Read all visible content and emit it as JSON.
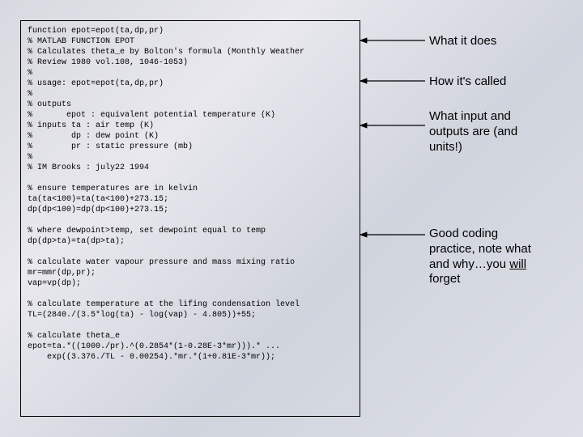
{
  "code": {
    "lines": [
      "function epot=epot(ta,dp,pr)",
      "% MATLAB FUNCTION EPOT",
      "% Calculates theta_e by Bolton's formula (Monthly Weather",
      "% Review 1980 vol.108, 1046-1053)",
      "%",
      "% usage: epot=epot(ta,dp,pr)",
      "%",
      "% outputs",
      "%       epot : equivalent potential temperature (K)",
      "% inputs ta : air temp (K)",
      "%        dp : dew point (K)",
      "%        pr : static pressure (mb)",
      "%",
      "% IM Brooks : july22 1994",
      "",
      "% ensure temperatures are in kelvin",
      "ta(ta<100)=ta(ta<100)+273.15;",
      "dp(dp<100)=dp(dp<100)+273.15;",
      "",
      "% where dewpoint>temp, set dewpoint equal to temp",
      "dp(dp>ta)=ta(dp>ta);",
      "",
      "% calculate water vapour pressure and mass mixing ratio",
      "mr=mmr(dp,pr);",
      "vap=vp(dp);",
      "",
      "% calculate temperature at the lifing condensation level",
      "TL=(2840./(3.5*log(ta) - log(vap) - 4.805))+55;",
      "",
      "% calculate theta_e",
      "epot=ta.*((1000./pr).^(0.2854*(1-0.28E-3*mr))).* ...",
      "    exp((3.376./TL - 0.00254).*mr.*(1+0.81E-3*mr));"
    ]
  },
  "annotations": {
    "a1": "What it does",
    "a2": "How it's called",
    "a3_1": "What input and",
    "a3_2": "outputs are (and",
    "a3_3": "units!)",
    "a4_1": "Good coding",
    "a4_2": "practice, note what",
    "a4_3": "and why…you ",
    "a4_will": "will",
    "a4_4": "forget"
  }
}
